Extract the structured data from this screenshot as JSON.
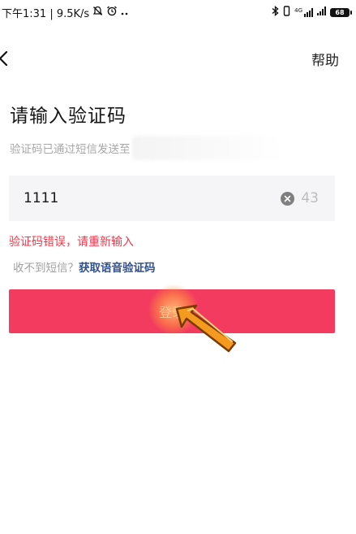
{
  "status_bar": {
    "time_info": "下午1:31 | 9.5K/s",
    "network_type": "4G",
    "battery_level": "68"
  },
  "header": {
    "help_label": "帮助"
  },
  "main": {
    "title": "请输入验证码",
    "subtitle": "验证码已通过短信发送至",
    "code_value": "1111",
    "countdown": "43",
    "error_message": "验证码错误，请重新输入",
    "voice_prompt": "收不到短信？",
    "voice_link": "获取语音验证码",
    "login_label": "登录"
  },
  "colors": {
    "accent": "#f23b5f",
    "error": "#f2364a",
    "link": "#2f4f8f"
  }
}
